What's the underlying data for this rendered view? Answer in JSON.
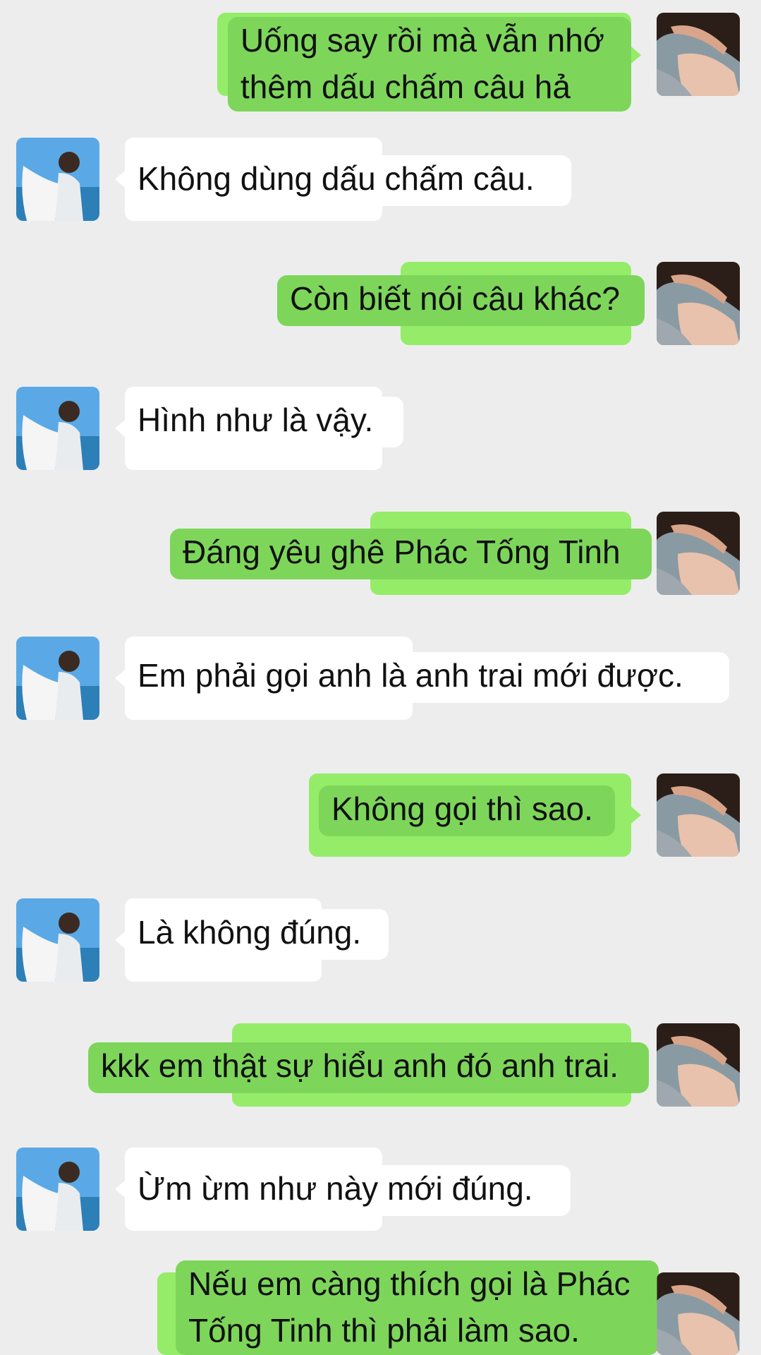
{
  "messages": [
    {
      "sender": "me",
      "avatar": "guy-hand-on-forehead-avatar",
      "lines": [
        "Uống say rồi mà vẫn nhớ",
        "thêm dấu chấm câu hả"
      ]
    },
    {
      "sender": "other",
      "avatar": "guy-at-sea-avatar",
      "lines": [
        "Không dùng dấu chấm câu."
      ]
    },
    {
      "sender": "me",
      "avatar": "guy-hand-on-forehead-avatar",
      "lines": [
        "Còn biết nói câu khác?"
      ]
    },
    {
      "sender": "other",
      "avatar": "guy-at-sea-avatar",
      "lines": [
        "Hình như là vậy."
      ]
    },
    {
      "sender": "me",
      "avatar": "guy-hand-on-forehead-avatar",
      "lines": [
        "Đáng yêu ghê Phác Tống Tinh"
      ]
    },
    {
      "sender": "other",
      "avatar": "guy-at-sea-avatar",
      "lines": [
        "Em phải gọi anh là anh trai mới được."
      ]
    },
    {
      "sender": "me",
      "avatar": "guy-hand-on-forehead-avatar",
      "lines": [
        "Không gọi thì sao."
      ]
    },
    {
      "sender": "other",
      "avatar": "guy-at-sea-avatar",
      "lines": [
        "Là không đúng."
      ]
    },
    {
      "sender": "me",
      "avatar": "guy-hand-on-forehead-avatar",
      "lines": [
        "kkk em thật sự hiểu anh đó anh trai."
      ]
    },
    {
      "sender": "other",
      "avatar": "guy-at-sea-avatar",
      "lines": [
        "Ừm ừm như này mới đúng."
      ]
    },
    {
      "sender": "me",
      "avatar": "guy-hand-on-forehead-avatar",
      "lines": [
        "Nếu em càng thích gọi là Phác",
        "Tống Tinh thì phải làm sao."
      ]
    }
  ],
  "colors": {
    "background": "#ededed",
    "my_bubble": "#7dd65a",
    "my_bubble_ghost": "#95ec69",
    "their_bubble": "#ffffff"
  }
}
